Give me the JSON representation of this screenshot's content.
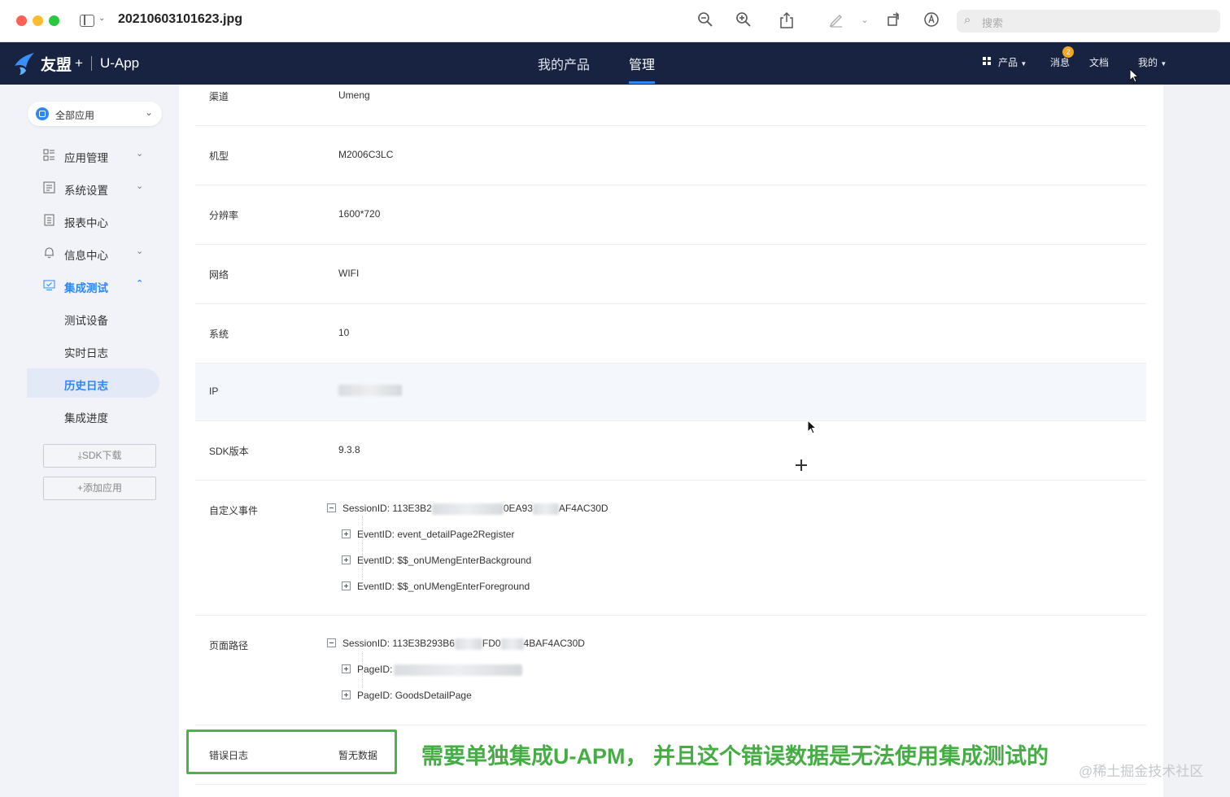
{
  "window": {
    "title": "20210603101623.jpg",
    "search_placeholder": "搜索"
  },
  "topnav": {
    "logo_text": "友盟",
    "logo_plus": "+",
    "logo_app": "U-App",
    "tabs": [
      {
        "label": "我的产品",
        "active": false
      },
      {
        "label": "管理",
        "active": true
      }
    ],
    "products_label": "产品",
    "messages_label": "消息",
    "messages_badge": "2",
    "docs_label": "文档",
    "mine_label": "我的",
    "accent_color": "#2f86f6",
    "bg_color": "#172340"
  },
  "sidebar": {
    "app_select": "全部应用",
    "items": [
      {
        "label": "应用管理",
        "icon": "app-list-icon",
        "expandable": true
      },
      {
        "label": "系统设置",
        "icon": "settings-icon",
        "expandable": true
      },
      {
        "label": "报表中心",
        "icon": "report-icon",
        "expandable": false
      },
      {
        "label": "信息中心",
        "icon": "bell-icon",
        "expandable": true
      },
      {
        "label": "集成测试",
        "icon": "integration-test-icon",
        "expandable": true,
        "active": true
      }
    ],
    "subitems": [
      {
        "label": "测试设备"
      },
      {
        "label": "实时日志"
      },
      {
        "label": "历史日志",
        "selected": true
      },
      {
        "label": "集成进度"
      }
    ],
    "sdk_download": "SDK下载",
    "add_app": "+添加应用"
  },
  "details": {
    "rows": [
      {
        "key": "渠道",
        "value": "Umeng"
      },
      {
        "key": "机型",
        "value": "M2006C3LC"
      },
      {
        "key": "分辨率",
        "value": "1600*720"
      },
      {
        "key": "网络",
        "value": "WIFI"
      },
      {
        "key": "系统",
        "value": "10"
      },
      {
        "key": "IP",
        "value": ""
      },
      {
        "key": "SDK版本",
        "value": "9.3.8"
      }
    ],
    "custom_events": {
      "key": "自定义事件",
      "session": "SessionID: 113E3B2",
      "session_mid": "0EA93",
      "session_tail": "AF4AC30D",
      "events": [
        "EventID: event_detailPage2Register",
        "EventID: $$_onUMengEnterBackground",
        "EventID: $$_onUMengEnterForeground"
      ]
    },
    "page_paths": {
      "key": "页面路径",
      "session": "SessionID: 113E3B293B6",
      "session_mid": "FD0",
      "session_tail": "4BAF4AC30D",
      "pages": [
        "PageID:",
        "PageID: GoodsDetailPage"
      ]
    },
    "error_log": {
      "key": "错误日志",
      "value": "暂无数据"
    }
  },
  "annotation": {
    "text": "需要单独集成U-APM， 并且这个错误数据是无法使用集成测试的",
    "color": "#46ad45"
  },
  "watermark": "@稀土掘金技术社区"
}
